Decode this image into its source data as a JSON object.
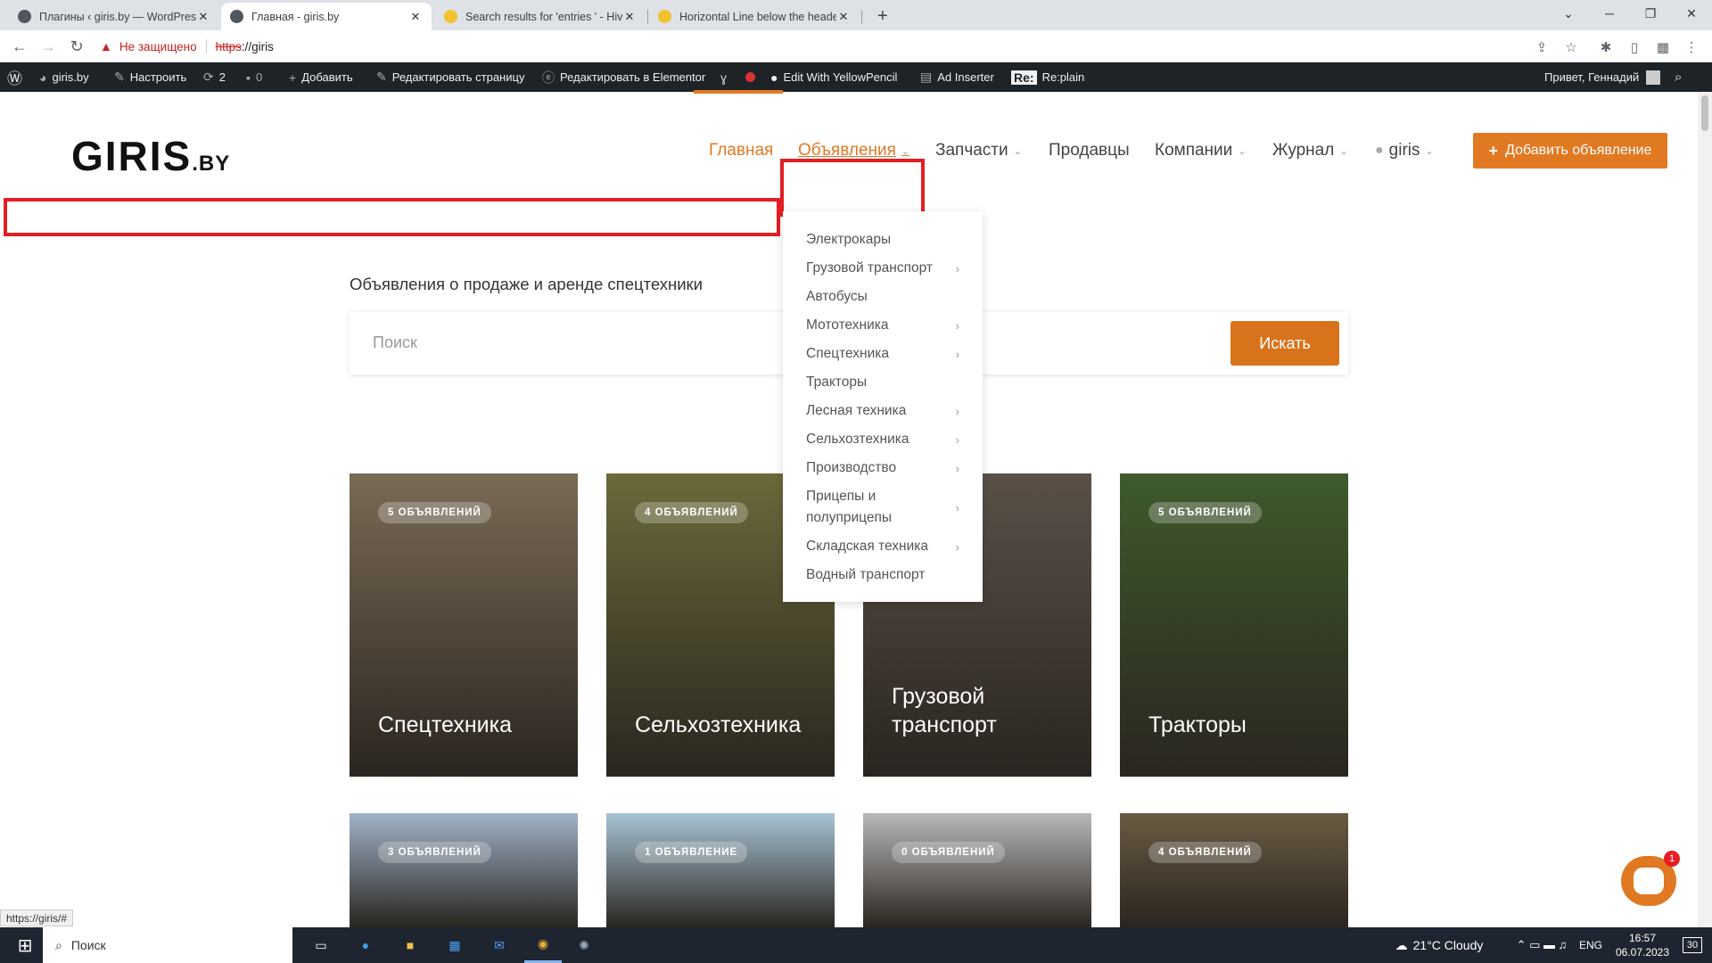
{
  "browser": {
    "tabs": [
      {
        "title": "Плагины ‹ giris.by — WordPress",
        "active": false
      },
      {
        "title": "Главная - giris.by",
        "active": true
      },
      {
        "title": "Search results for 'entries ' - Hive",
        "active": false
      },
      {
        "title": "Horizontal Line below the header",
        "active": false
      }
    ],
    "new_tab": "+",
    "security_text": "Не защищено",
    "url_scheme": "https",
    "url_rest": "://giris"
  },
  "wp_admin_bar": {
    "site_name": "giris.by",
    "customize": "Настроить",
    "updates_count": "2",
    "comments_count": "0",
    "add_new": "Добавить",
    "edit_page": "Редактировать страницу",
    "edit_elementor": "Редактировать в Elementor",
    "yellowpencil": "Edit With YellowPencil",
    "ad_inserter": "Ad Inserter",
    "replain_badge": "Re:",
    "replain": "Re:plain",
    "greeting": "Привет, Геннадий"
  },
  "site": {
    "logo_main": "GIRIS",
    "logo_suffix": ".BY",
    "nav": [
      {
        "label": "Главная",
        "active": true,
        "dropdown": false
      },
      {
        "label": "Объявления",
        "active": true,
        "dropdown": true
      },
      {
        "label": "Запчасти",
        "active": false,
        "dropdown": true
      },
      {
        "label": "Продавцы",
        "active": false,
        "dropdown": false
      },
      {
        "label": "Компании",
        "active": false,
        "dropdown": true
      },
      {
        "label": "Журнал",
        "active": false,
        "dropdown": true
      },
      {
        "label": "giris",
        "active": false,
        "dropdown": true
      }
    ],
    "add_button": "Добавить объявление",
    "dropdown_items": [
      {
        "label": "Электрокары",
        "sub": false
      },
      {
        "label": "Грузовой транспорт",
        "sub": true
      },
      {
        "label": "Автобусы",
        "sub": false
      },
      {
        "label": "Мототехника",
        "sub": true
      },
      {
        "label": "Спецтехника",
        "sub": true
      },
      {
        "label": "Тракторы",
        "sub": false
      },
      {
        "label": "Лесная техника",
        "sub": true
      },
      {
        "label": "Сельхозтехника",
        "sub": true
      },
      {
        "label": "Производство",
        "sub": true
      },
      {
        "label": "Прицепы и полуприцепы",
        "sub": true
      },
      {
        "label": "Складская техника",
        "sub": true
      },
      {
        "label": "Водный транспорт",
        "sub": false
      }
    ],
    "subtitle": "Объявления о продаже и аренде спецтехники",
    "search_placeholder": "Поиск",
    "search_button": "Искать",
    "categories": [
      {
        "name": "Спецтехника",
        "count": "5 ОБЪЯВЛЕНИЙ",
        "color": "#7a6a55"
      },
      {
        "name": "Сельхозтехника",
        "count": "4 ОБЪЯВЛЕНИЙ",
        "color": "#6b6a3a"
      },
      {
        "name": "Грузовой транспорт",
        "count": "",
        "color": "#5a5048"
      },
      {
        "name": "Тракторы",
        "count": "5 ОБЪЯВЛЕНИЙ",
        "color": "#3e5a2c"
      },
      {
        "name": "",
        "count": "3 ОБЪЯВЛЕНИЙ",
        "color": "#9fb3c8"
      },
      {
        "name": "",
        "count": "1 ОБЪЯВЛЕНИЕ",
        "color": "#a8c4d4"
      },
      {
        "name": "",
        "count": "0 ОБЪЯВЛЕНИЙ",
        "color": "#b8b8b8"
      },
      {
        "name": "",
        "count": "4 ОБЪЯВЛЕНИЙ",
        "color": "#6a5a42"
      }
    ],
    "chat_badge": "1"
  },
  "status_url": "https://giris/#",
  "taskbar": {
    "search": "Поиск",
    "weather": "21°C  Cloudy",
    "lang": "ENG",
    "time": "16:57",
    "date": "06.07.2023",
    "notif": "30"
  }
}
